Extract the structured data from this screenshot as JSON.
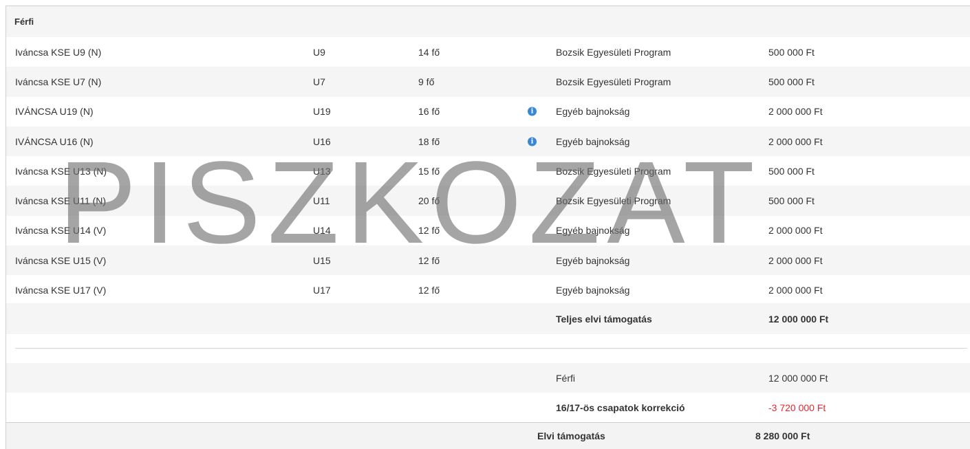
{
  "section": {
    "title": "Férfi"
  },
  "rows": [
    {
      "name": "Iváncsa KSE U9 (N)",
      "age": "U9",
      "count": "14 fő",
      "info": false,
      "competition": "Bozsik Egyesületi Program",
      "amount": "500 000 Ft"
    },
    {
      "name": "Iváncsa KSE U7 (N)",
      "age": "U7",
      "count": "9 fő",
      "info": false,
      "competition": "Bozsik Egyesületi Program",
      "amount": "500 000 Ft"
    },
    {
      "name": "IVÁNCSA U19 (N)",
      "age": "U19",
      "count": "16 fő",
      "info": true,
      "competition": "Egyéb bajnokság",
      "amount": "2 000 000 Ft"
    },
    {
      "name": "IVÁNCSA U16 (N)",
      "age": "U16",
      "count": "18 fő",
      "info": true,
      "competition": "Egyéb bajnokság",
      "amount": "2 000 000 Ft"
    },
    {
      "name": "Iváncsa KSE U13 (N)",
      "age": "U13",
      "count": "15 fő",
      "info": false,
      "competition": "Bozsik Egyesületi Program",
      "amount": "500 000 Ft"
    },
    {
      "name": "Iváncsa KSE U11 (N)",
      "age": "U11",
      "count": "20 fő",
      "info": false,
      "competition": "Bozsik Egyesületi Program",
      "amount": "500 000 Ft"
    },
    {
      "name": "Iváncsa KSE U14 (V)",
      "age": "U14",
      "count": "12 fő",
      "info": false,
      "competition": "Egyéb bajnokság",
      "amount": "2 000 000 Ft"
    },
    {
      "name": "Iváncsa KSE U15 (V)",
      "age": "U15",
      "count": "12 fő",
      "info": false,
      "competition": "Egyéb bajnokság",
      "amount": "2 000 000 Ft"
    },
    {
      "name": "Iváncsa KSE U17 (V)",
      "age": "U17",
      "count": "12 fő",
      "info": false,
      "competition": "Egyéb bajnokság",
      "amount": "2 000 000 Ft"
    }
  ],
  "total": {
    "label": "Teljes elvi támogatás",
    "amount": "12 000 000 Ft"
  },
  "summary": {
    "men_label": "Férfi",
    "men_amount": "12 000 000 Ft",
    "correction_label": "16/17-ös csapatok korrekció",
    "correction_amount": "-3 720 000 Ft"
  },
  "final": {
    "label": "Elvi támogatás",
    "amount": "8 280 000 Ft"
  },
  "info_icon_glyph": "i",
  "watermark": "PISZKOZAT",
  "colors": {
    "info": "#3a87d6",
    "negative": "#e8262e",
    "stripe": "#f5f5f5"
  }
}
